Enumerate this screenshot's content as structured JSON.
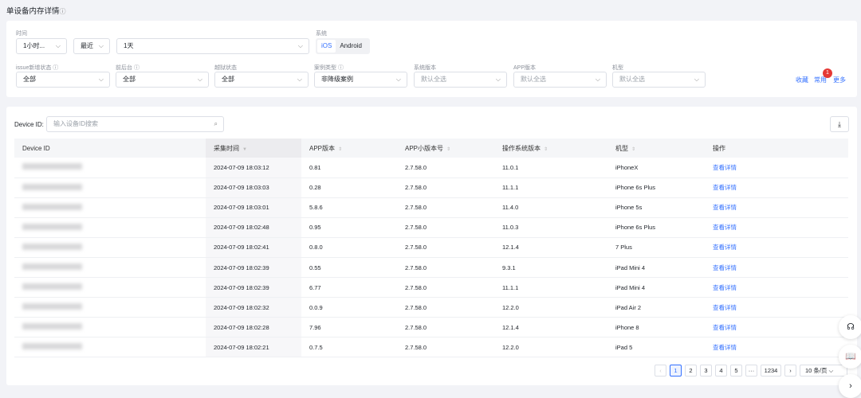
{
  "title": "单设备内存详情",
  "filters": {
    "time_label": "时间",
    "time_unit": "1小时...",
    "time_recent": "最近",
    "time_range": "1天",
    "system_label": "系统",
    "system_options": [
      "iOS",
      "Android"
    ],
    "system_selected": "iOS",
    "issue_label": "issue新增状态",
    "issue_value": "全部",
    "fg_label": "前后台",
    "fg_value": "全部",
    "jb_label": "越狱状态",
    "jb_value": "全部",
    "case_label": "案例类型",
    "case_value": "非降级案例",
    "osver_label": "系统版本",
    "osver_value": "默认全选",
    "appver_label": "APP版本",
    "appver_value": "默认全选",
    "model_label": "机型",
    "model_value": "默认全选",
    "favorite": "收藏",
    "common": "常用",
    "common_badge": "1",
    "more": "更多"
  },
  "search": {
    "label": "Device ID:",
    "placeholder": "输入设备ID搜索"
  },
  "table": {
    "columns": [
      "Device ID",
      "采集时间",
      "APP版本",
      "APP小版本号",
      "操作系统版本",
      "机型",
      "操作"
    ],
    "rows": [
      [
        "2024-07-09 18:03:12",
        "0.81",
        "2.7.58.0",
        "11.0.1",
        "iPhoneX",
        "查看详情"
      ],
      [
        "2024-07-09 18:03:03",
        "0.28",
        "2.7.58.0",
        "11.1.1",
        "iPhone 6s Plus",
        "查看详情"
      ],
      [
        "2024-07-09 18:03:01",
        "5.8.6",
        "2.7.58.0",
        "11.4.0",
        "iPhone 5s",
        "查看详情"
      ],
      [
        "2024-07-09 18:02:48",
        "0.95",
        "2.7.58.0",
        "11.0.3",
        "iPhone 6s Plus",
        "查看详情"
      ],
      [
        "2024-07-09 18:02:41",
        "0.8.0",
        "2.7.58.0",
        "12.1.4",
        "7 Plus",
        "查看详情"
      ],
      [
        "2024-07-09 18:02:39",
        "0.55",
        "2.7.58.0",
        "9.3.1",
        "iPad Mini 4",
        "查看详情"
      ],
      [
        "2024-07-09 18:02:39",
        "6.77",
        "2.7.58.0",
        "11.1.1",
        "iPad Mini 4",
        "查看详情"
      ],
      [
        "2024-07-09 18:02:32",
        "0.0.9",
        "2.7.58.0",
        "12.2.0",
        "iPad Air 2",
        "查看详情"
      ],
      [
        "2024-07-09 18:02:28",
        "7.96",
        "2.7.58.0",
        "12.1.4",
        "iPhone 8",
        "查看详情"
      ],
      [
        "2024-07-09 18:02:21",
        "0.7.5",
        "2.7.58.0",
        "12.2.0",
        "iPad 5",
        "查看详情"
      ]
    ]
  },
  "pagination": {
    "pages": [
      "1",
      "2",
      "3",
      "4",
      "5",
      "···",
      "1234"
    ],
    "current": "1",
    "page_size": "10 条/页"
  }
}
